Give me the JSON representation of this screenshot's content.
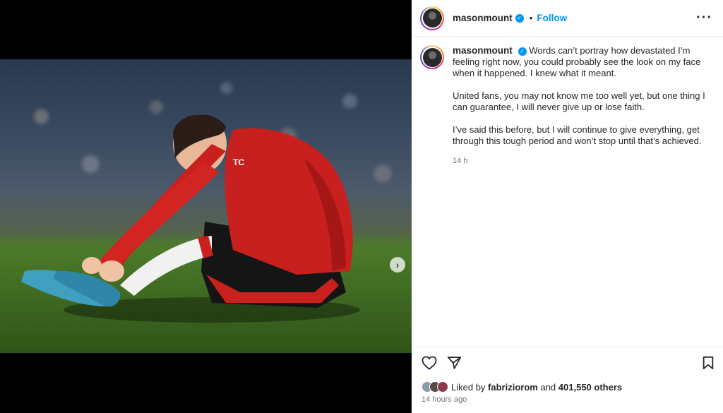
{
  "post": {
    "username": "masonmount",
    "follow_label": "Follow",
    "separator": "•",
    "more_icon": "more-horizontal-icon",
    "caption": {
      "paragraph1": "Words can’t portray how devastated I’m feeling right now, you could probably see the look on my face when it happened. I knew what it meant.",
      "paragraph2": "United fans, you may not know me too well yet, but one thing I can guarantee, I will never give up or lose faith.",
      "paragraph3": "I’ve said this before, but I will continue to give everything, get through this tough period and won’t stop until that’s achieved.",
      "time": "14 h"
    },
    "media": {
      "carousel_position": 1,
      "carousel_count": 2
    },
    "likes": {
      "prefix": "Liked by",
      "user": "fabriziorom",
      "connector": "and",
      "count_text": "401,550 others"
    },
    "posted_time": "14 hours ago"
  },
  "colors": {
    "accent": "#0095f6",
    "text": "#262626",
    "muted": "#737373"
  }
}
